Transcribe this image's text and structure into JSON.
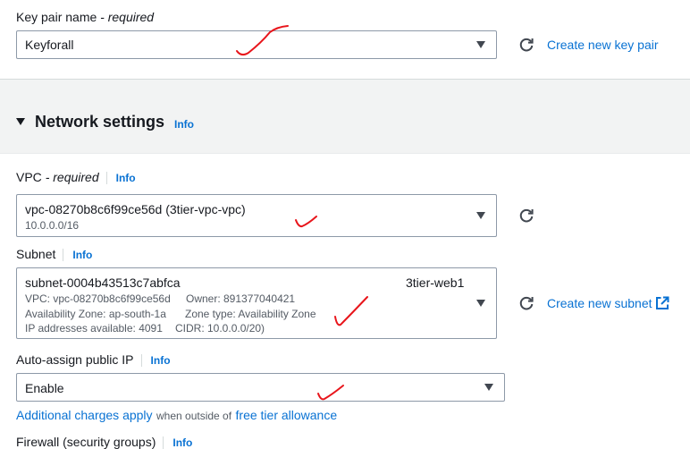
{
  "key_pair": {
    "label": "Key pair name",
    "required": "- required",
    "value": "Keyforall",
    "create_link": "Create new key pair"
  },
  "network": {
    "title": "Network settings",
    "info": "Info"
  },
  "vpc": {
    "label": "VPC",
    "required": "- required",
    "info": "Info",
    "value": "vpc-08270b8c6f99ce56d (3tier-vpc-vpc)",
    "cidr": "10.0.0.0/16"
  },
  "subnet": {
    "label": "Subnet",
    "info": "Info",
    "value": "subnet-0004b43513c7abfca",
    "name": "3tier-web1",
    "vpc_line": "VPC: vpc-08270b8c6f99ce56d",
    "owner_line": "Owner: 891377040421",
    "az_line": "Availability Zone: ap-south-1a",
    "zone_type_line": "Zone type: Availability Zone",
    "ip_line": "IP addresses available: 4091",
    "cidr_line": "CIDR: 10.0.0.0/20)",
    "create_link": "Create new subnet"
  },
  "auto_ip": {
    "label": "Auto-assign public IP",
    "info": "Info",
    "value": "Enable"
  },
  "charges": {
    "link1": "Additional charges apply",
    "middle": "when outside of",
    "link2": "free tier allowance"
  },
  "firewall": {
    "label": "Firewall (security groups)",
    "info": "Info"
  },
  "colors": {
    "link": "#0972d3",
    "border": "#8d99a8",
    "section_bg": "#f2f3f3",
    "annotation": "#e8151b"
  },
  "icons": [
    "refresh-icon",
    "caret-down-icon",
    "external-link-icon",
    "expand-triangle-icon",
    "check-mark-annotation"
  ]
}
